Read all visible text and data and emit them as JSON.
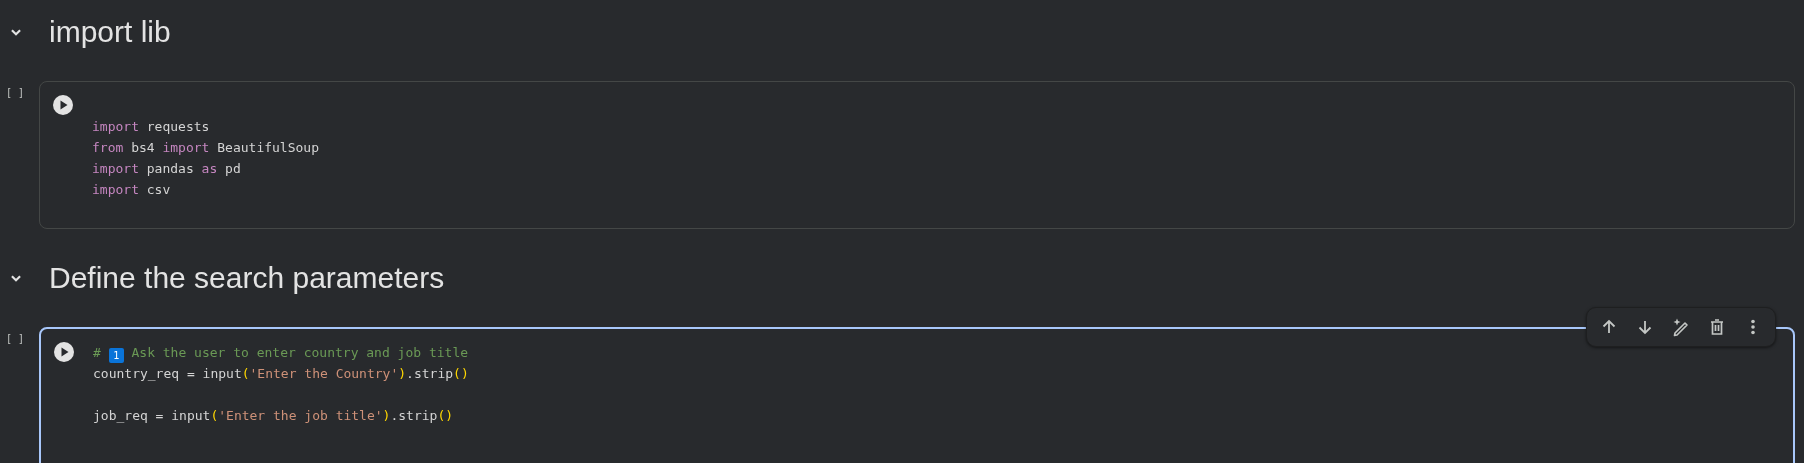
{
  "sections": [
    {
      "title": "import lib",
      "expanded": true,
      "cell": {
        "execution_count": "[ ]",
        "selected": false,
        "lines": [
          {
            "gap_before": true,
            "tokens": [
              {
                "kind": "keyword",
                "text": "import"
              },
              {
                "kind": "plain",
                "text": " requests"
              }
            ]
          },
          {
            "tokens": [
              {
                "kind": "keyword",
                "text": "from"
              },
              {
                "kind": "plain",
                "text": " bs4 "
              },
              {
                "kind": "keyword",
                "text": "import"
              },
              {
                "kind": "plain",
                "text": " BeautifulSoup"
              }
            ]
          },
          {
            "tokens": [
              {
                "kind": "keyword",
                "text": "import"
              },
              {
                "kind": "plain",
                "text": " pandas "
              },
              {
                "kind": "keyword",
                "text": "as"
              },
              {
                "kind": "plain",
                "text": " pd"
              }
            ]
          },
          {
            "tokens": [
              {
                "kind": "keyword",
                "text": "import"
              },
              {
                "kind": "plain",
                "text": " csv"
              }
            ]
          }
        ]
      }
    },
    {
      "title": "Define the search parameters",
      "expanded": true,
      "cell": {
        "execution_count": "[ ]",
        "selected": true,
        "lines": [
          {
            "tokens": [
              {
                "kind": "comment",
                "text": "# "
              },
              {
                "kind": "keycap",
                "text": "1"
              },
              {
                "kind": "comment",
                "text": " Ask the user to enter country and job title"
              }
            ]
          },
          {
            "tokens": [
              {
                "kind": "plain",
                "text": "country_req = input"
              },
              {
                "kind": "paren",
                "text": "("
              },
              {
                "kind": "string",
                "text": "'Enter the Country'"
              },
              {
                "kind": "paren",
                "text": ")"
              },
              {
                "kind": "plain",
                "text": ".strip"
              },
              {
                "kind": "paren",
                "text": "()"
              }
            ]
          },
          {
            "gap_before": true,
            "tokens": [
              {
                "kind": "plain",
                "text": "job_req = input"
              },
              {
                "kind": "paren",
                "text": "("
              },
              {
                "kind": "string",
                "text": "'Enter the job title'"
              },
              {
                "kind": "paren",
                "text": ")"
              },
              {
                "kind": "plain",
                "text": ".strip"
              },
              {
                "kind": "paren",
                "text": "()"
              }
            ]
          }
        ]
      }
    }
  ]
}
